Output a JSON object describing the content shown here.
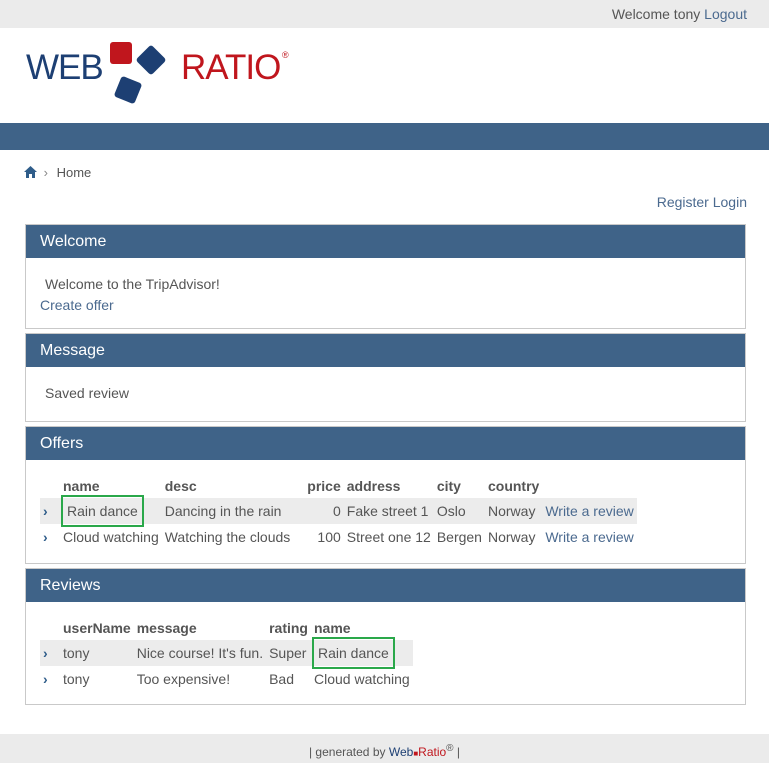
{
  "topbar": {
    "welcome_text": "Welcome tony",
    "logout_label": "Logout"
  },
  "logo": {
    "word1": "WEB",
    "word2": "RATIO",
    "registered": "®"
  },
  "breadcrumb": {
    "home_label": "Home",
    "separator": "›"
  },
  "auth": {
    "register_label": "Register",
    "login_label": "Login"
  },
  "welcome_panel": {
    "title": "Welcome",
    "text": "Welcome to the TripAdvisor!",
    "create_offer_label": "Create offer"
  },
  "message_panel": {
    "title": "Message",
    "text": "Saved review"
  },
  "offers_panel": {
    "title": "Offers",
    "columns": [
      "name",
      "desc",
      "price",
      "address",
      "city",
      "country"
    ],
    "rows": [
      {
        "name": "Rain dance",
        "desc": "Dancing in the rain",
        "price": "0",
        "address": "Fake street 1",
        "city": "Oslo",
        "country": "Norway",
        "action": "Write a review"
      },
      {
        "name": "Cloud watching",
        "desc": "Watching the clouds",
        "price": "100",
        "address": "Street one 12",
        "city": "Bergen",
        "country": "Norway",
        "action": "Write a review"
      }
    ]
  },
  "reviews_panel": {
    "title": "Reviews",
    "columns": [
      "userName",
      "message",
      "rating",
      "name"
    ],
    "rows": [
      {
        "userName": "tony",
        "message": "Nice course! It's fun.",
        "rating": "Super",
        "name": "Rain dance"
      },
      {
        "userName": "tony",
        "message": "Too expensive!",
        "rating": "Bad",
        "name": "Cloud watching"
      }
    ]
  },
  "footer": {
    "prefix": "| generated by",
    "brand_web": "Web",
    "brand_ratio": "Ratio",
    "registered": "®",
    "suffix": "|"
  },
  "colors": {
    "brand_blue": "#1d3f73",
    "brand_red": "#c0161d",
    "header_bar": "#3f6388",
    "link": "#4b6a8f",
    "highlight_border": "#2aa84a"
  },
  "icons": {
    "home": "home-icon",
    "row_arrow": "chevron-right-icon"
  }
}
